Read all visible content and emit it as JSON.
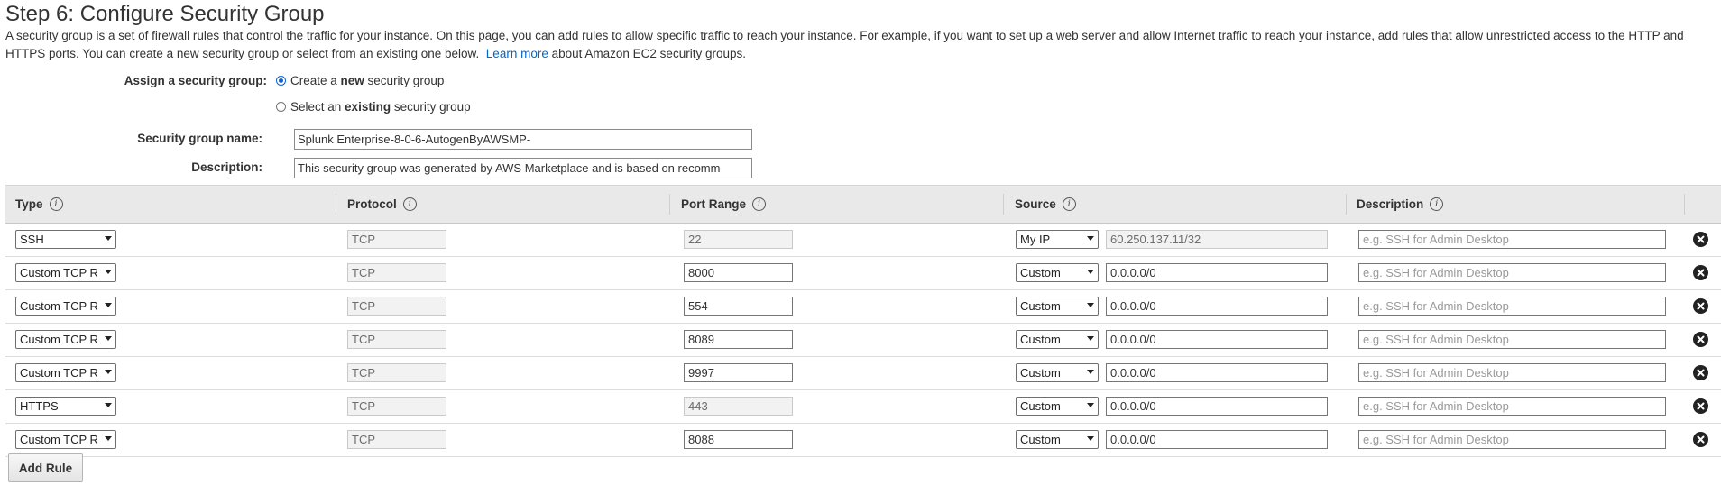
{
  "page_title": "Step 6: Configure Security Group",
  "intro": {
    "text": "A security group is a set of firewall rules that control the traffic for your instance. On this page, you can add rules to allow specific traffic to reach your instance. For example, if you want to set up a web server and allow Internet traffic to reach your instance, add rules that allow unrestricted access to the HTTP and HTTPS ports. You can create a new security group or select from an existing one below.",
    "link_text": "Learn more",
    "trailing_text": "about Amazon EC2 security groups."
  },
  "assign": {
    "label": "Assign a security group:",
    "option_new": {
      "prefix": "Create a ",
      "bold": "new",
      "suffix": " security group",
      "selected": true
    },
    "option_existing": {
      "prefix": "Select an ",
      "bold": "existing",
      "suffix": " security group",
      "selected": false
    }
  },
  "group_name": {
    "label": "Security group name:",
    "value": "Splunk Enterprise-8-0-6-AutogenByAWSMP-"
  },
  "group_description": {
    "label": "Description:",
    "value": "This security group was generated by AWS Marketplace and is based on recomm"
  },
  "table": {
    "columns": {
      "type": "Type",
      "protocol": "Protocol",
      "port_range": "Port Range",
      "source": "Source",
      "description": "Description"
    },
    "description_placeholder": "e.g. SSH for Admin Desktop",
    "rows": [
      {
        "type": "SSH",
        "protocol": "TCP",
        "port": "22",
        "port_editable": false,
        "source_type": "My IP",
        "source_value": "60.250.137.11/32",
        "source_editable": false
      },
      {
        "type": "Custom TCP R",
        "protocol": "TCP",
        "port": "8000",
        "port_editable": true,
        "source_type": "Custom",
        "source_value": "0.0.0.0/0",
        "source_editable": true
      },
      {
        "type": "Custom TCP R",
        "protocol": "TCP",
        "port": "554",
        "port_editable": true,
        "source_type": "Custom",
        "source_value": "0.0.0.0/0",
        "source_editable": true
      },
      {
        "type": "Custom TCP R",
        "protocol": "TCP",
        "port": "8089",
        "port_editable": true,
        "source_type": "Custom",
        "source_value": "0.0.0.0/0",
        "source_editable": true
      },
      {
        "type": "Custom TCP R",
        "protocol": "TCP",
        "port": "9997",
        "port_editable": true,
        "source_type": "Custom",
        "source_value": "0.0.0.0/0",
        "source_editable": true
      },
      {
        "type": "HTTPS",
        "protocol": "TCP",
        "port": "443",
        "port_editable": false,
        "source_type": "Custom",
        "source_value": "0.0.0.0/0",
        "source_editable": true
      },
      {
        "type": "Custom TCP R",
        "protocol": "TCP",
        "port": "8088",
        "port_editable": true,
        "source_type": "Custom",
        "source_value": "0.0.0.0/0",
        "source_editable": true
      }
    ]
  },
  "add_rule_label": "Add Rule",
  "colors": {
    "link": "#0066cc",
    "header_bg": "#e9e9e9",
    "radio_accent": "#0a64d6"
  }
}
